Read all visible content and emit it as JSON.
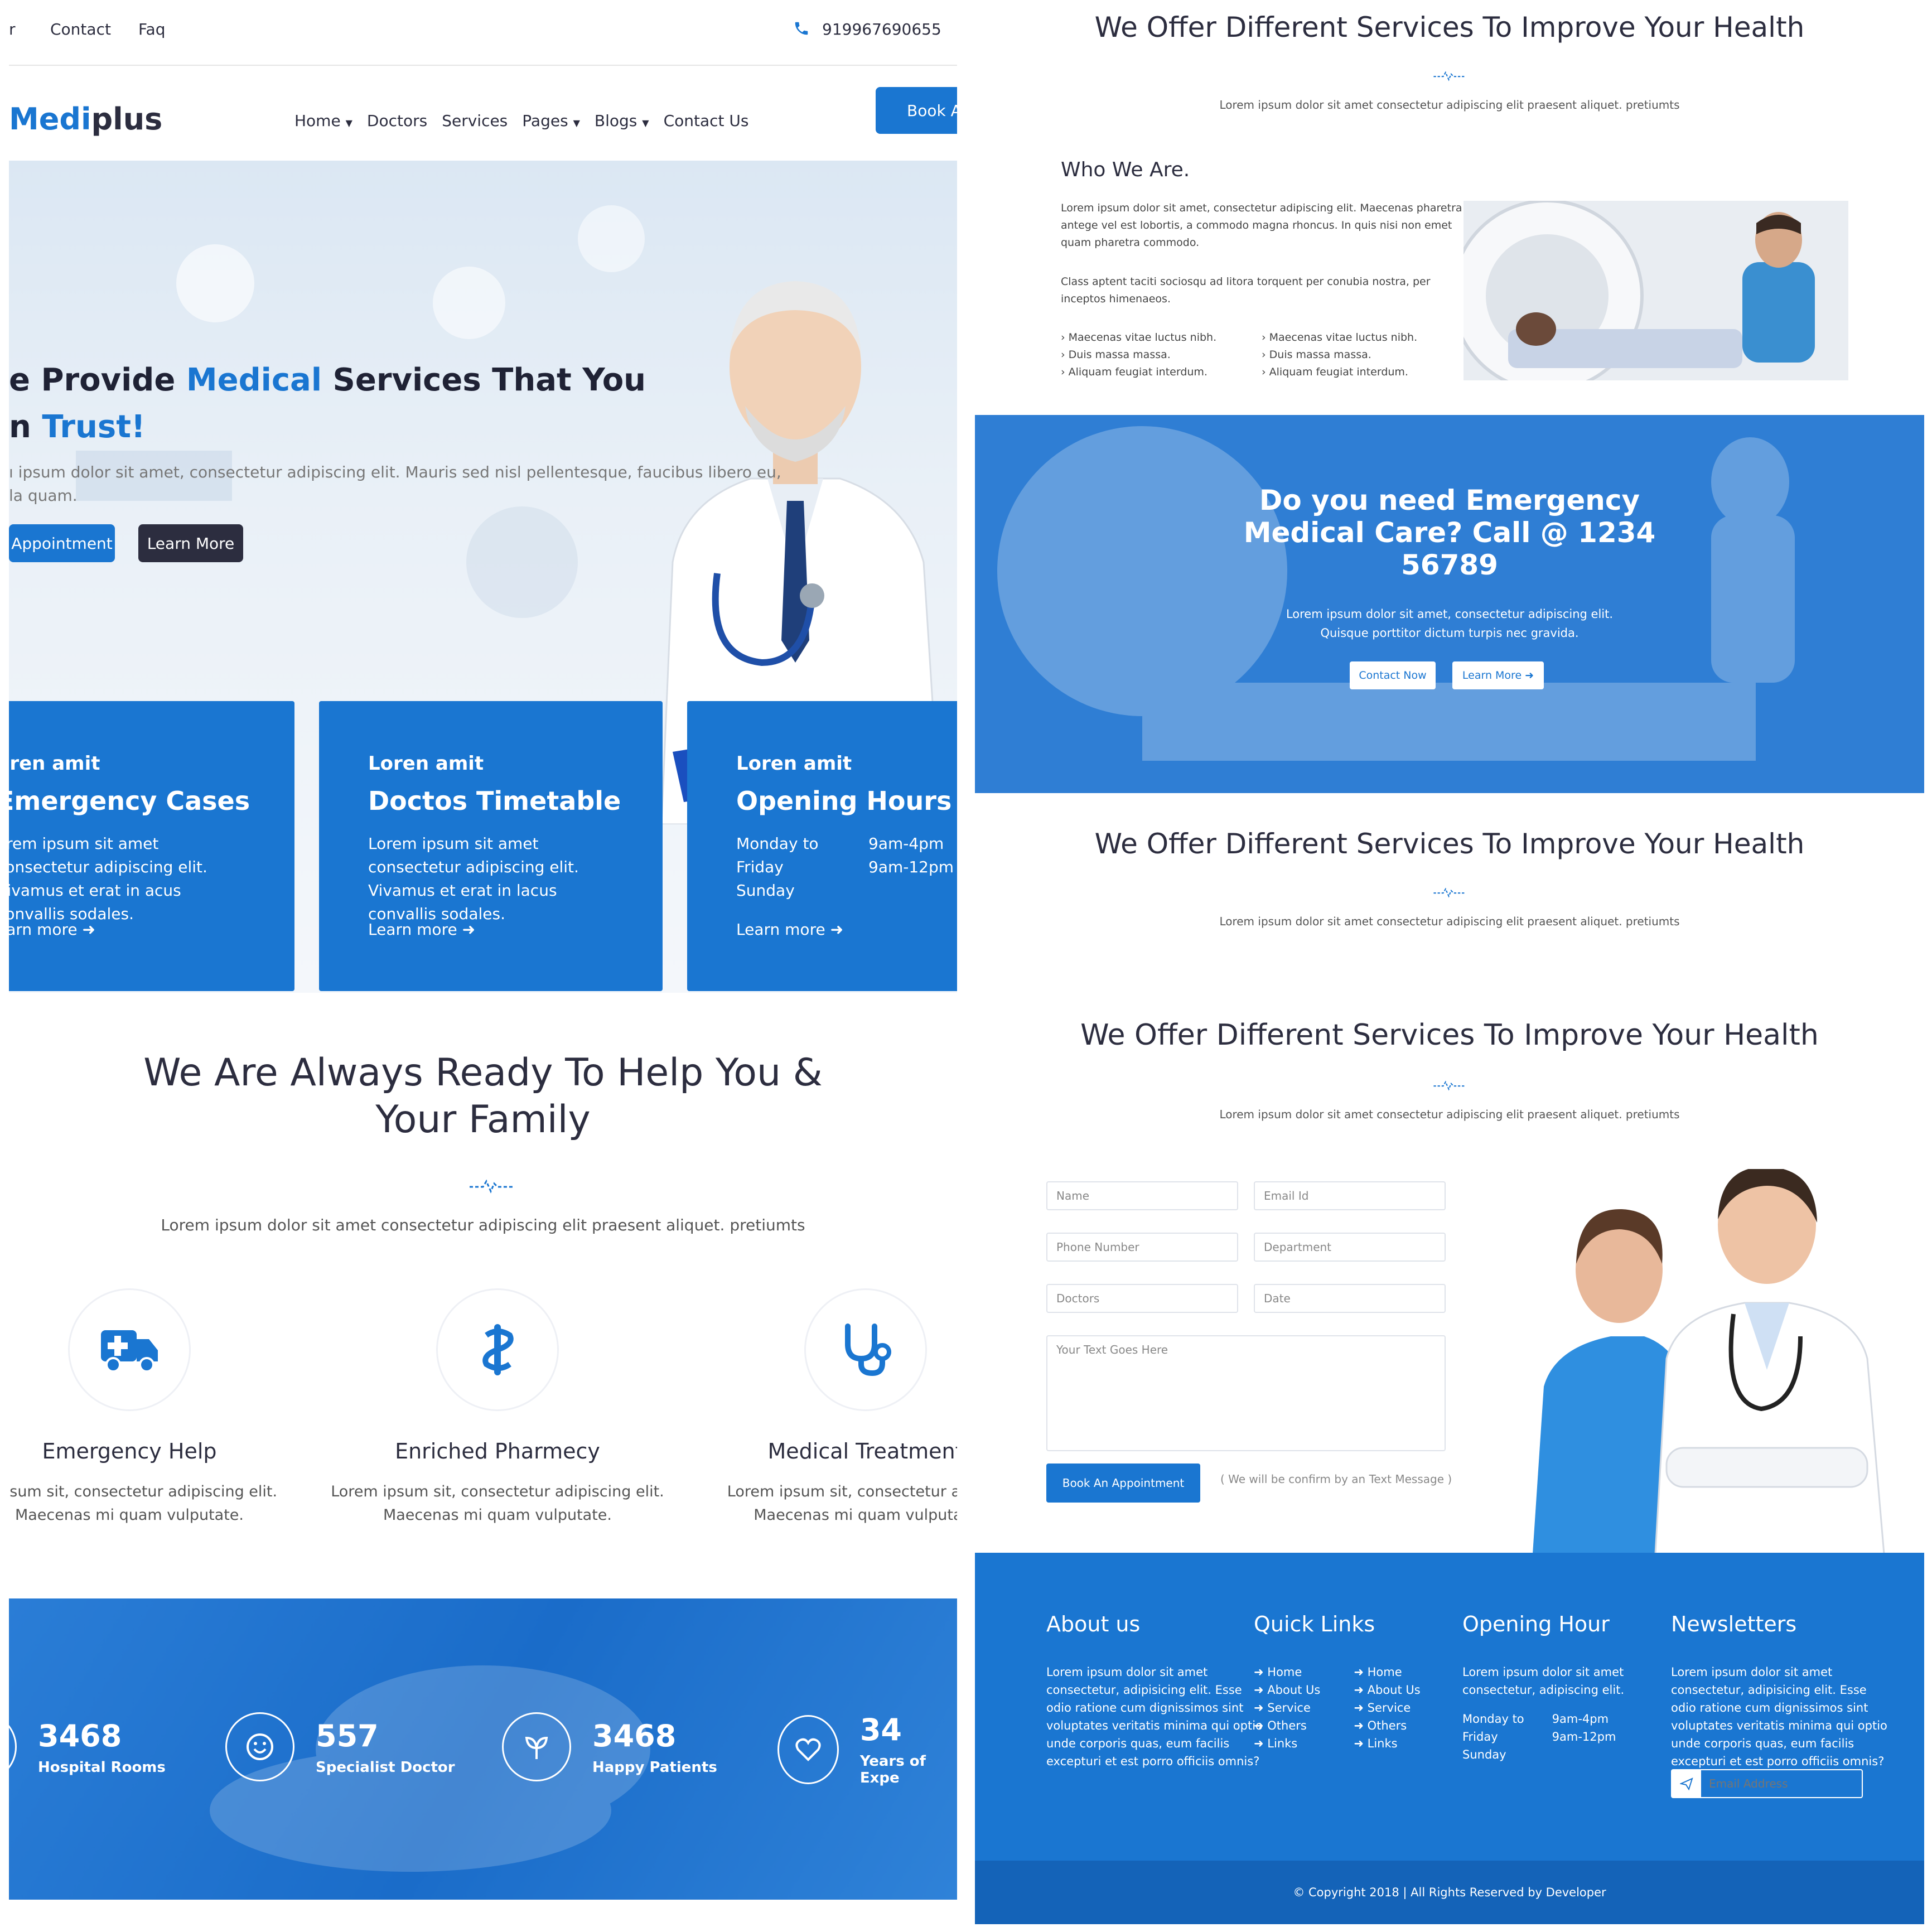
{
  "topbar": {
    "left_cut": "r",
    "links": [
      "Contact",
      "Faq"
    ],
    "phone": "919967690655"
  },
  "header": {
    "logo_prefix": "Medi",
    "logo_suffix": "plus",
    "nav": [
      {
        "label": "Home",
        "dropdown": true
      },
      {
        "label": "Doctors",
        "dropdown": false
      },
      {
        "label": "Services",
        "dropdown": false
      },
      {
        "label": "Pages",
        "dropdown": true
      },
      {
        "label": "Blogs",
        "dropdown": true
      },
      {
        "label": "Contact Us",
        "dropdown": false
      }
    ],
    "cta": "Book A"
  },
  "hero": {
    "title_l1a": "e Provide ",
    "title_l1b": "Medical",
    "title_l1c": " Services That You",
    "title_l2a": "n ",
    "title_l2b": "Trust!",
    "desc_l1": "ı ipsum dolor sit amet, consectetur adipiscing elit. Mauris sed nisl pellentesque, faucibus libero eu,",
    "desc_l2": "la quam.",
    "btn_primary": "Appointment",
    "btn_secondary": "Learn More"
  },
  "cards": [
    {
      "sub": "oren amit",
      "title": "Emergency Cases",
      "text": "orem ipsum sit amet consectetur adipiscing elit. Vivamus et erat in acus convallis sodales.",
      "more": "earn more"
    },
    {
      "sub": "Loren amit",
      "title": "Doctos Timetable",
      "text": "Lorem ipsum sit amet consectetur adipiscing elit. Vivamus et erat in lacus convallis sodales.",
      "more": "Learn more"
    },
    {
      "sub": "Loren amit",
      "title": "Opening Hours",
      "days": [
        "Monday to",
        "Friday",
        "Sunday"
      ],
      "hours": [
        "9am-4pm",
        "9am-12pm"
      ],
      "more": "Learn more"
    }
  ],
  "ready": {
    "title_l1": "We Are Always Ready To Help You &",
    "title_l2": "Your Family",
    "desc": "Lorem ipsum dolor sit amet consectetur adipiscing elit praesent aliquet. pretiumts"
  },
  "services": [
    {
      "icon": "ambulance-icon",
      "name": "Emergency Help",
      "d1": "n ipsum sit, consectetur adipiscing elit.",
      "d2": "Maecenas mi quam vulputate."
    },
    {
      "icon": "pharmacy-icon",
      "name": "Enriched Pharmecy",
      "d1": "Lorem ipsum sit, consectetur adipiscing elit.",
      "d2": "Maecenas mi quam vulputate."
    },
    {
      "icon": "stethoscope-icon",
      "name": "Medical Treatment",
      "d1": "Lorem ipsum sit, consectetur adipisc",
      "d2": "Maecenas mi quam vulputate"
    }
  ],
  "stats": [
    {
      "icon": "bed-icon",
      "num": "3468",
      "label": "Hospital Rooms"
    },
    {
      "icon": "smile-icon",
      "num": "557",
      "label": "Specialist Doctor"
    },
    {
      "icon": "plant-icon",
      "num": "3468",
      "label": "Happy Patients"
    },
    {
      "icon": "heart-icon",
      "num": "34",
      "label": "Years of Expe"
    }
  ],
  "section_title": "We Offer Different Services To Improve Your Health",
  "section_desc": "Lorem ipsum dolor sit amet consectetur adipiscing elit praesent aliquet. pretiumts",
  "who": {
    "title": "Who We Are.",
    "p1_l1": "Lorem ipsum dolor sit amet, consectetur adipiscing elit. Maecenas pharetra",
    "p1_l2": "antege vel est lobortis, a commodo magna rhoncus. In quis nisi non emet",
    "p1_l3": "quam pharetra commodo.",
    "p2_l1": "Class aptent taciti sociosqu ad litora torquent per conubia nostra, per",
    "p2_l2": "inceptos himenaeos.",
    "list_a": [
      "Maecenas vitae luctus nibh.",
      "Duis massa massa.",
      "Aliquam feugiat interdum."
    ],
    "list_b": [
      "Maecenas vitae luctus nibh.",
      "Duis massa massa.",
      "Aliquam feugiat interdum."
    ]
  },
  "emergency": {
    "l1": "Do you need Emergency",
    "l2": "Medical Care? Call @ 1234",
    "l3": "56789",
    "d1": "Lorem ipsum dolor sit amet, consectetur adipiscing elit.",
    "d2": "Quisque porttitor dictum turpis nec gravida.",
    "btn1": "Contact Now",
    "btn2": "Learn More"
  },
  "form": {
    "name": "Name",
    "email": "Email Id",
    "phone": "Phone Number",
    "department": "Department",
    "doctors": "Doctors",
    "date": "Date",
    "message": "Your Text Goes Here",
    "submit": "Book An Appointment",
    "note": "( We will be confirm by an Text Message )"
  },
  "footer": {
    "about_title": "About us",
    "about_lines": [
      "Lorem ipsum dolor sit amet",
      "consectetur, adipisicing elit. Esse",
      "odio ratione cum dignissimos sint",
      "voluptates veritatis minima qui optio",
      "unde corporis quas, eum facilis",
      "excepturi et est porro officiis omnis?"
    ],
    "links_title": "Quick Links",
    "links": [
      "Home",
      "About Us",
      "Service",
      "Others",
      "Links"
    ],
    "hours_title": "Opening Hour",
    "hours_lines": [
      "Lorem ipsum dolor sit amet",
      "consectetur, adipiscing elit."
    ],
    "days": [
      "Monday to",
      "Friday",
      "Sunday"
    ],
    "times": [
      "9am-4pm",
      "9am-12pm"
    ],
    "news_title": "Newsletters",
    "news_lines": [
      "Lorem ipsum dolor sit amet",
      "consectetur, adipisicing elit. Esse",
      "odio ratione cum dignissimos sint",
      "voluptates veritatis minima qui optio",
      "unde corporis quas, eum facilis",
      "excepturi et est porro officiis omnis?"
    ],
    "email_placeholder": "Email Address",
    "copyright": "© Copyright 2018 | All Rights Reserved by Developer"
  },
  "colors": {
    "primary": "#1a76d1",
    "dark": "#2c2d3f",
    "footer_bottom": "#1463b8"
  }
}
